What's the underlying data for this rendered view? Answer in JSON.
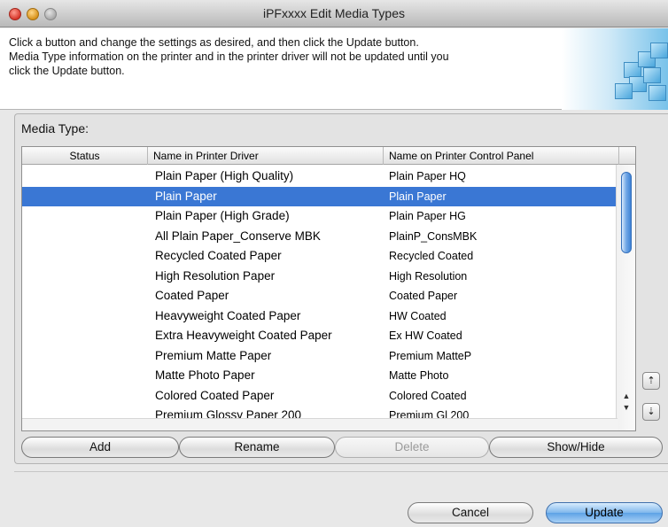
{
  "window": {
    "title": "iPFxxxx Edit Media Types"
  },
  "banner": {
    "line1": "Click a button and change the settings as desired, and then click the Update button.",
    "line2": "Media Type information on the printer and in the printer driver will not be updated until you",
    "line3": "click the Update button."
  },
  "media_type_label": "Media Type:",
  "table": {
    "headers": {
      "status": "Status",
      "name": "Name in Printer Driver",
      "panel": "Name on Printer Control Panel"
    },
    "rows": [
      {
        "status": "",
        "name": "Plain Paper (High Quality)",
        "panel": "Plain Paper HQ"
      },
      {
        "status": "",
        "name": "Plain Paper",
        "panel": "Plain Paper"
      },
      {
        "status": "",
        "name": "Plain Paper (High Grade)",
        "panel": "Plain Paper HG"
      },
      {
        "status": "",
        "name": "All Plain Paper_Conserve MBK",
        "panel": "PlainP_ConsMBK"
      },
      {
        "status": "",
        "name": "Recycled Coated Paper",
        "panel": "Recycled Coated"
      },
      {
        "status": "",
        "name": "High Resolution Paper",
        "panel": "High Resolution"
      },
      {
        "status": "",
        "name": "Coated Paper",
        "panel": "Coated Paper"
      },
      {
        "status": "",
        "name": "Heavyweight Coated Paper",
        "panel": "HW Coated"
      },
      {
        "status": "",
        "name": "Extra Heavyweight Coated Paper",
        "panel": "Ex HW Coated"
      },
      {
        "status": "",
        "name": "Premium Matte Paper",
        "panel": "Premium MatteP"
      },
      {
        "status": "",
        "name": "Matte Photo Paper",
        "panel": "Matte Photo"
      },
      {
        "status": "",
        "name": "Colored Coated Paper",
        "panel": "Colored Coated"
      },
      {
        "status": "",
        "name": "Premium Glossy Paper 200",
        "panel": "Premium Gl 200"
      }
    ],
    "selected_index": 1
  },
  "side_buttons": {
    "move_up_icon": "move-up-icon",
    "move_down_icon": "move-down-icon"
  },
  "buttons": {
    "add": "Add",
    "rename": "Rename",
    "delete": "Delete",
    "show_hide": "Show/Hide",
    "cancel": "Cancel",
    "update": "Update"
  },
  "colors": {
    "selection": "#3a77d4",
    "default_button": "#5da2e6"
  }
}
